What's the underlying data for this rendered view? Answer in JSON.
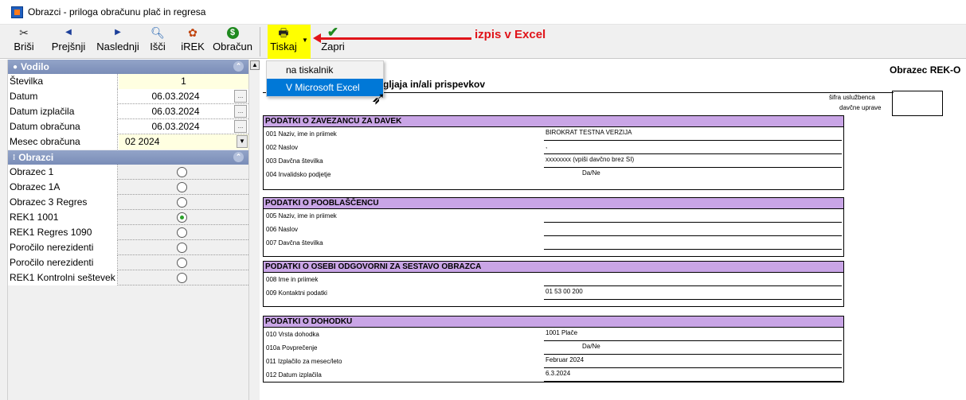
{
  "window": {
    "title": "Obrazci - priloga obračunu plač in regresa"
  },
  "toolbar": {
    "brisi": "Briši",
    "prejsnji": "Prejšnji",
    "naslednji": "Naslednji",
    "isci": "Išči",
    "irek": "iREK",
    "obracun": "Obračun",
    "tiskaj": "Tiskaj",
    "zapri": "Zapri"
  },
  "annotation": {
    "text": "izpis v Excel",
    "color": "#e0141a"
  },
  "print_menu": {
    "items": [
      "na tiskalnik",
      "V Microsoft Excel"
    ],
    "selected_index": 1
  },
  "vodilo": {
    "header": "Vodilo",
    "stevilka_label": "Številka",
    "stevilka_value": "1",
    "datum_label": "Datum",
    "datum_value": "06.03.2024",
    "datum_izplacila_label": "Datum izplačila",
    "datum_izplacila_value": "06.03.2024",
    "datum_obracuna_label": "Datum obračuna",
    "datum_obracuna_value": "06.03.2024",
    "mesec_label": "Mesec obračuna",
    "mesec_value": "02  2024",
    "dots": "..."
  },
  "obrazci": {
    "header": "Obrazci",
    "items": [
      {
        "label": "Obrazec 1",
        "selected": false
      },
      {
        "label": "Obrazec 1A",
        "selected": false
      },
      {
        "label": "Obrazec 3 Regres",
        "selected": false
      },
      {
        "label": "REK1 1001",
        "selected": true
      },
      {
        "label": "REK1 Regres 1090",
        "selected": false
      },
      {
        "label": "Poročilo nerezidenti",
        "selected": false
      },
      {
        "label": "Poročilo nerezidenti Regres",
        "selected": false
      },
      {
        "label": "REK1 Kontrolni seštevek",
        "selected": false
      }
    ]
  },
  "form": {
    "title": "Obrazec REK-O",
    "subtitle_partial": "gljaja in/ali prispevkov",
    "sifra_label": "šifra uslužbenca",
    "davcne_label": "davčne uprave",
    "s1_header": "PODATKI O ZAVEZANCU ZA DAVEK",
    "s1_r1_label": "001  Naziv, ime in priimek",
    "s1_r1_value": "BIROKRAT TESTNA VERZIJA",
    "s1_r2_label": "002  Naslov",
    "s1_r2_value": ",",
    "s1_r3_label": "003  Davčna številka",
    "s1_r3_value": "xxxxxxxx   (vpiši davčno brez SI)",
    "s1_r4_label": "004  Invalidsko podjetje",
    "s1_r4_value": "Da/Ne",
    "s2_header": "PODATKI O POOBLAŠČENCU",
    "s2_r1_label": "005  Naziv, ime in priimek",
    "s2_r2_label": "006  Naslov",
    "s2_r3_label": "007  Davčna številka",
    "s3_header": "PODATKI O OSEBI ODGOVORNI ZA SESTAVO OBRAZCA",
    "s3_r1_label": "008  Ime in priimek",
    "s3_r2_label": "009  Kontaktni podatki",
    "s3_r2_value": "01 53 00 200",
    "s4_header": "PODATKI O DOHODKU",
    "s4_r1_label": "010  Vrsta dohodka",
    "s4_r1_value": "1001 Plače",
    "s4_r2_label": "010a Povprečenje",
    "s4_r2_value": "Da/Ne",
    "s4_r3_label": "011  Izplačilo za mesec/leto",
    "s4_r3_value": "Februar  2024",
    "s4_r4_label": "012  Datum izplačila",
    "s4_r4_value": "6.3.2024"
  }
}
